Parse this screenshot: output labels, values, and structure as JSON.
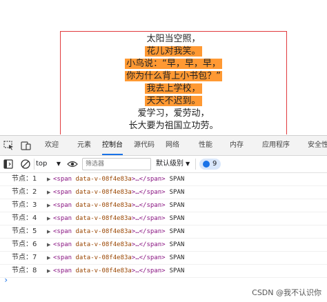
{
  "poem": {
    "lines": [
      {
        "text": "太阳当空照，",
        "highlight": false
      },
      {
        "text": "花儿对我笑。",
        "highlight": true
      },
      {
        "text": "小鸟说：“早，早，早，",
        "highlight": true
      },
      {
        "text": "你为什么背上小书包？”",
        "highlight": true
      },
      {
        "text": "我去上学校，",
        "highlight": true
      },
      {
        "text": "天天不迟到。",
        "highlight": true
      },
      {
        "text": "爱学习，爱劳动，",
        "highlight": false
      },
      {
        "text": "长大要为祖国立功劳。",
        "highlight": false
      }
    ],
    "highlight_color": "#ff9933",
    "frame_color": "#e0393c"
  },
  "devtools": {
    "tabs": [
      {
        "label": "欢迎",
        "active": false
      },
      {
        "label": "元素",
        "active": false
      },
      {
        "label": "控制台",
        "active": true
      },
      {
        "label": "源代码",
        "active": false
      },
      {
        "label": "网络",
        "active": false
      },
      {
        "label": "性能",
        "active": false
      },
      {
        "label": "内存",
        "active": false
      },
      {
        "label": "应用程序",
        "active": false
      },
      {
        "label": "安全性",
        "active": false
      }
    ],
    "toolbar": {
      "context": "top",
      "filter_placeholder": "筛选器",
      "level": "默认级别",
      "issues_count": "9"
    },
    "logs": [
      {
        "label": "节点：1",
        "tag_open": "<span",
        "attr": "data-v-08f4e83a",
        "rest": ">…</span>",
        "type": "SPAN"
      },
      {
        "label": "节点：2",
        "tag_open": "<span",
        "attr": "data-v-08f4e83a",
        "rest": ">…</span>",
        "type": "SPAN"
      },
      {
        "label": "节点：3",
        "tag_open": "<span",
        "attr": "data-v-08f4e83a",
        "rest": ">…</span>",
        "type": "SPAN"
      },
      {
        "label": "节点：4",
        "tag_open": "<span",
        "attr": "data-v-08f4e83a",
        "rest": ">…</span>",
        "type": "SPAN"
      },
      {
        "label": "节点：5",
        "tag_open": "<span",
        "attr": "data-v-08f4e83a",
        "rest": ">…</span>",
        "type": "SPAN"
      },
      {
        "label": "节点：6",
        "tag_open": "<span",
        "attr": "data-v-08f4e83a",
        "rest": ">…</span>",
        "type": "SPAN"
      },
      {
        "label": "节点：7",
        "tag_open": "<span",
        "attr": "data-v-08f4e83a",
        "rest": ">…</span>",
        "type": "SPAN"
      },
      {
        "label": "节点：8",
        "tag_open": "<span",
        "attr": "data-v-08f4e83a",
        "rest": ">…</span>",
        "type": "SPAN"
      }
    ],
    "prompt_symbol": "›",
    "icons": {
      "inspect": "inspect-icon",
      "device": "device-toggle-icon",
      "sidebar": "sidebar-toggle-icon",
      "clear": "clear-console-icon",
      "eye": "live-expression-icon",
      "issues": "issues-icon"
    }
  },
  "watermark": "CSDN @我不认识你"
}
